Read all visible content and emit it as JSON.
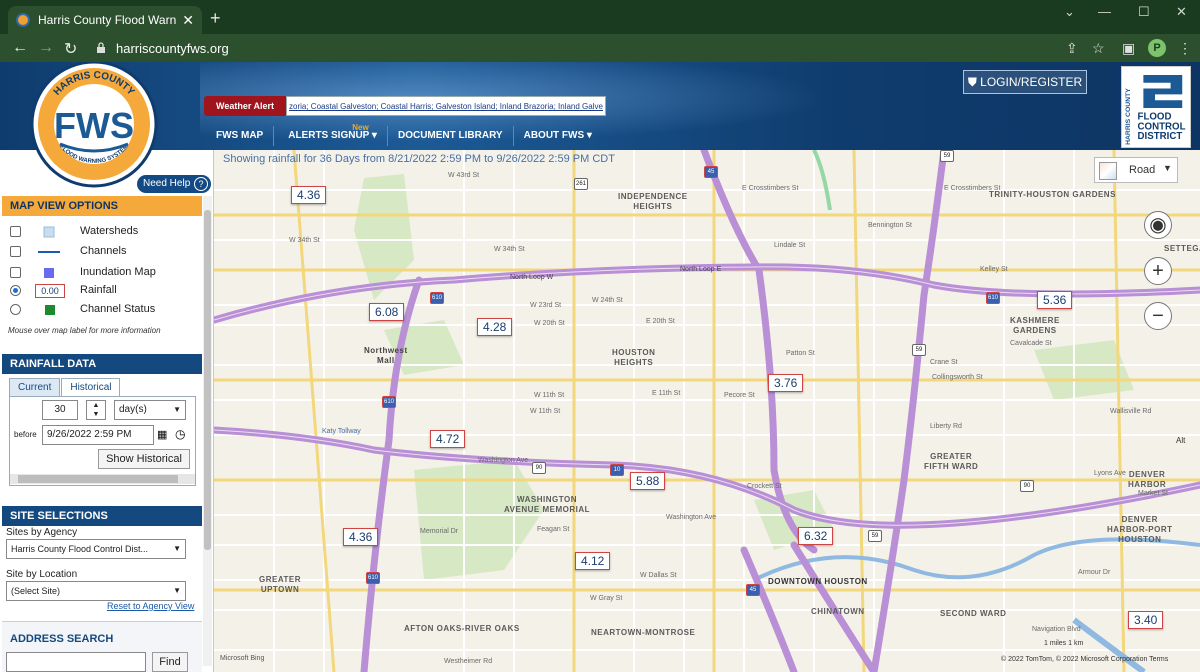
{
  "browser": {
    "tab_title": "Harris County Flood Warning Sys",
    "tab_close": "✕",
    "new_tab": "+",
    "url": "harriscountyfws.org",
    "profile_initial": "P"
  },
  "header": {
    "logo_text": "FWS",
    "logo_top": "HARRIS COUNTY",
    "logo_bottom": "FLOOD WARNING SYSTEM",
    "alert_label": "Weather Alert",
    "alert_text": "zoria; Coastal Galveston; Coastal Harris; Galveston Island; Inland Brazoria; Inland Galve",
    "login": "LOGIN/REGISTER",
    "hcfcd": [
      "HARRIS COUNTY",
      "FLOOD",
      "CONTROL",
      "DISTRICT"
    ],
    "nav": [
      {
        "label": "FWS MAP"
      },
      {
        "label": "ALERTS SIGNUP ▾",
        "badge": "New"
      },
      {
        "label": "DOCUMENT LIBRARY"
      },
      {
        "label": "ABOUT FWS ▾"
      }
    ]
  },
  "sidebar": {
    "need_help": "Need Help",
    "map_view_title": "MAP VIEW OPTIONS",
    "options": [
      {
        "label": "Watersheds",
        "type": "checkbox",
        "checked": false
      },
      {
        "label": "Channels",
        "type": "checkbox",
        "checked": false
      },
      {
        "label": "Inundation Map",
        "type": "checkbox",
        "checked": false
      },
      {
        "label": "Rainfall",
        "type": "radio",
        "checked": true,
        "sample": "0.00"
      },
      {
        "label": "Channel Status",
        "type": "radio",
        "checked": false
      }
    ],
    "mouseover_note": "Mouse over map label for more information",
    "rainfall_title": "RAINFALL DATA",
    "tab_current": "Current",
    "tab_historical": "Historical",
    "period_value": "30",
    "period_unit": "day(s)",
    "before_label": "before",
    "before_value": "9/26/2022 2:59 PM",
    "show_historical": "Show Historical",
    "site_title": "SITE SELECTIONS",
    "sites_by_agency_label": "Sites by Agency",
    "agency_value": "Harris County Flood Control Dist...",
    "site_by_location_label": "Site by Location",
    "location_value": "(Select Site)",
    "reset_link": "Reset to Agency View",
    "address_title": "ADDRESS SEARCH",
    "find_button": "Find"
  },
  "map": {
    "showing": "Showing rainfall for 36 Days from 8/21/2022 2:59 PM to 9/26/2022 2:59 PM CDT",
    "basemap": "Road",
    "rainfall_labels": [
      {
        "value": "4.36"
      },
      {
        "value": "6.08"
      },
      {
        "value": "4.28"
      },
      {
        "value": "5.36"
      },
      {
        "value": "3.76"
      },
      {
        "value": "4.72"
      },
      {
        "value": "5.88"
      },
      {
        "value": "4.36"
      },
      {
        "value": "6.32"
      },
      {
        "value": "4.12"
      },
      {
        "value": "3.40"
      }
    ],
    "places": [
      "INDEPENDENCE\nHEIGHTS",
      "TRINITY-HOUSTON GARDENS",
      "KASHMERE\nGARDENS",
      "HOUSTON\nHEIGHTS",
      "Northwest\nMall",
      "GREATER\nFIFTH WARD",
      "DENVER\nHARBOR",
      "DENVER\nHARBOR-PORT\nHOUSTON",
      "WASHINGTON\nAVENUE MEMORIAL",
      "GREATER\nUPTOWN",
      "DOWNTOWN HOUSTON",
      "CHINATOWN",
      "SECOND WARD",
      "AFTON OAKS-RIVER OAKS",
      "NEARTOWN-MONTROSE",
      "SETTEGA"
    ],
    "streets": [
      "W 43rd St",
      "E Crosstimbers St",
      "E Crosstimbers St",
      "W 34th St",
      "W 34th St",
      "Lindale St",
      "Bennington St",
      "Kelley St",
      "W 23rd St",
      "W 24th St",
      "W 20th St",
      "E 20th St",
      "Cavalcade St",
      "Patton St",
      "Crane St",
      "Collingsworth St",
      "W 11th St",
      "Pecore St",
      "E 11th St",
      "W 11th St",
      "Liberty Rd",
      "Katy Tollway",
      "Washington Ave",
      "Crockett St",
      "Washington Ave",
      "Memorial Dr",
      "Feagan St",
      "W Dallas St",
      "W Gray St",
      "Westheimer Rd",
      "Lyons Ave",
      "Market St",
      "Armour Dr",
      "Navigation Blvd",
      "North Loop W",
      "North Loop E",
      "Wallisville Rd"
    ],
    "attribution": "© 2022 TomTom, © 2022 Microsoft Corporation  Terms",
    "bing": "Microsoft Bing",
    "scale": "1 miles   1 km",
    "alt_label": "Alt"
  },
  "colors": {
    "header_blue": "#0f3c6e",
    "section_blue": "#14497f",
    "accent_orange": "#f5a93a",
    "highway_purple": "#b98fd6",
    "alert_red": "#a0151d"
  }
}
